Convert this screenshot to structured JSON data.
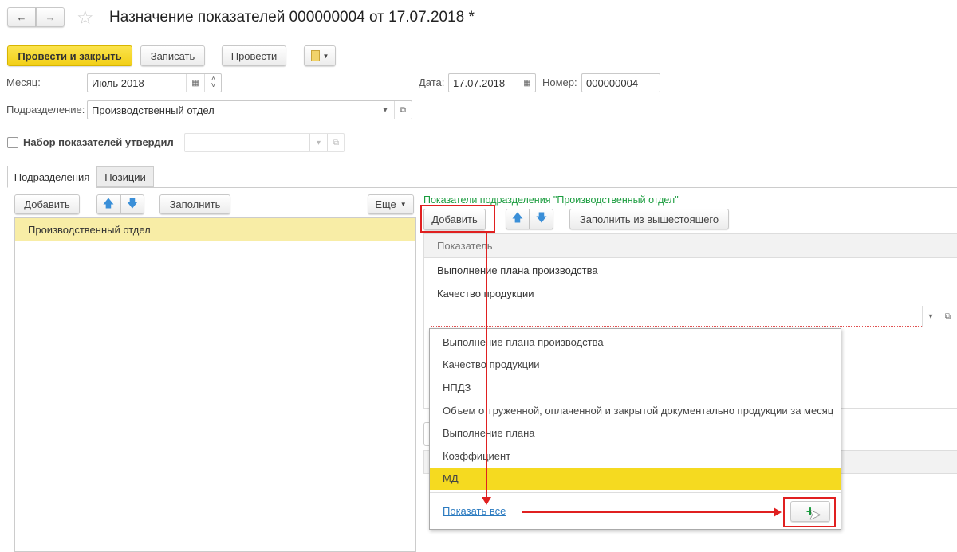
{
  "header": {
    "title": "Назначение показателей 000000004 от 17.07.2018 *",
    "back": "←",
    "forward": "→"
  },
  "toolbar": {
    "post_close": "Провести и закрыть",
    "save": "Записать",
    "post": "Провести"
  },
  "fields": {
    "month_label": "Месяц:",
    "month_value": "Июль 2018",
    "date_label": "Дата:",
    "date_value": "17.07.2018",
    "number_label": "Номер:",
    "number_value": "000000004",
    "division_label": "Подразделение:",
    "division_value": "Производственный отдел",
    "approved_label": "Набор показателей утвердил",
    "approved_value": ""
  },
  "tabs": [
    {
      "label": "Подразделения"
    },
    {
      "label": "Позиции"
    }
  ],
  "left": {
    "add": "Добавить",
    "fill": "Заполнить",
    "more": "Еще",
    "rows": [
      "Производственный отдел"
    ]
  },
  "right": {
    "title": "Показатели подразделения \"Производственный отдел\"",
    "add": "Добавить",
    "fill": "Заполнить из вышестоящего",
    "column": "Показатель",
    "rows": [
      "Выполнение плана производства",
      "Качество продукции"
    ],
    "edit_value": ""
  },
  "dropdown": {
    "items": [
      "Выполнение плана производства",
      "Качество продукции",
      "НПДЗ",
      "Объем отгруженной, оплаченной и закрытой документально продукции за месяц",
      "Выполнение плана",
      "Коэффициент",
      "МД"
    ],
    "selected": 6,
    "show_all": "Показать все",
    "create": "+"
  },
  "colors": {
    "accent": "#f2cf17",
    "selection": "#f8eda6",
    "annotation": "#e02020",
    "title_green": "#1a9c3e"
  }
}
